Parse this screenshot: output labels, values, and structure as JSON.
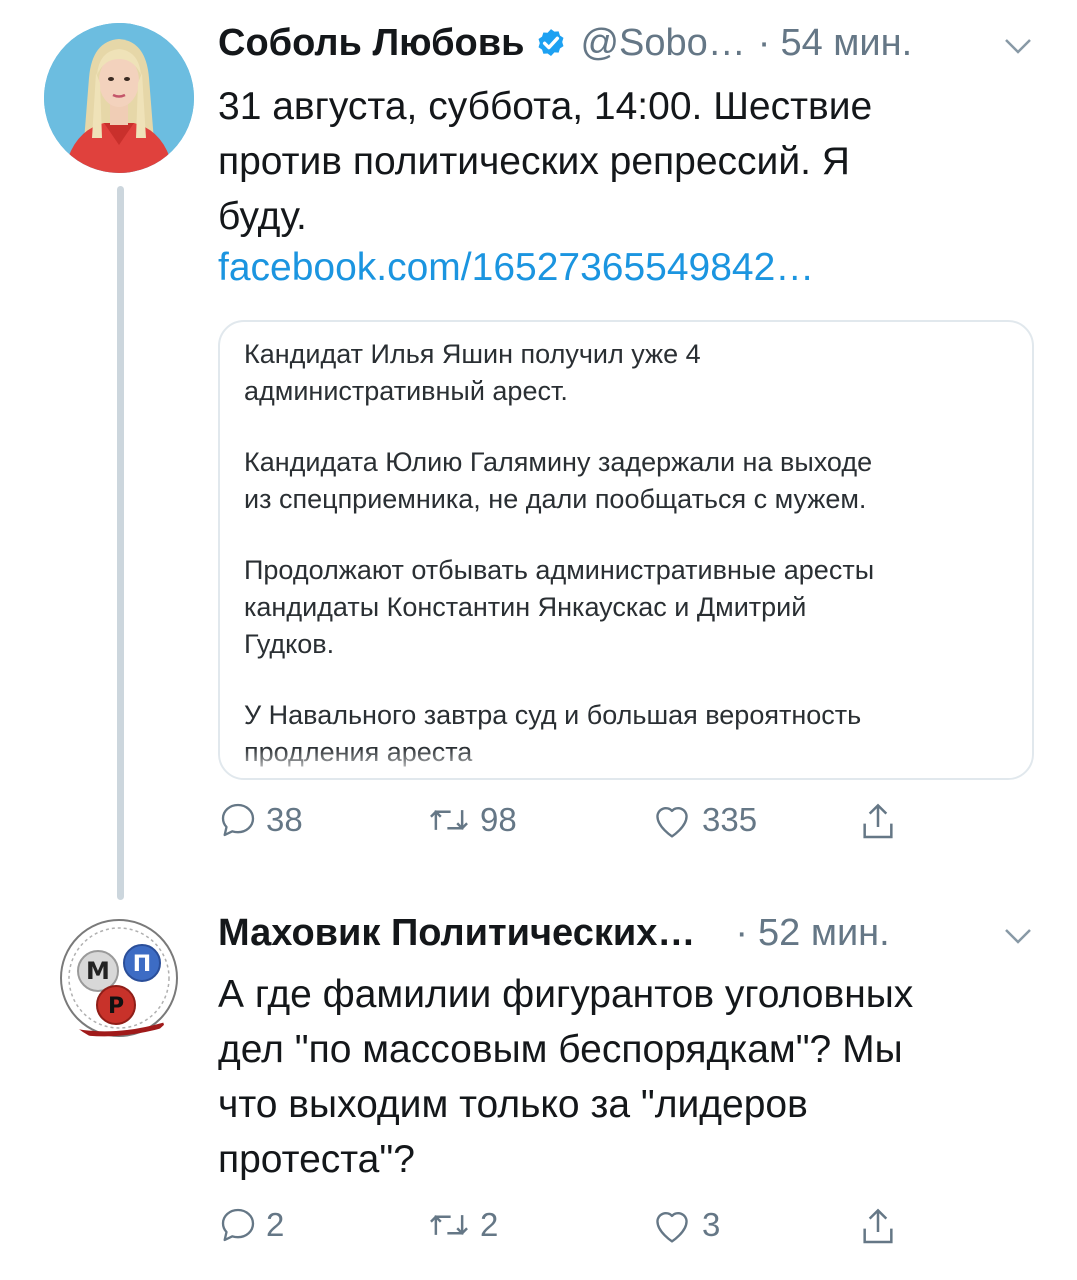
{
  "tweets": [
    {
      "author_name": "Соболь Любовь",
      "handle": "@Sobo…",
      "dot": "·",
      "time": "54 мин.",
      "verified": true,
      "avatar_icon": "person-portrait",
      "text_lines": [
        "31 августа, суббота, 14:00. Шествие",
        "против политических репрессий. Я",
        "буду."
      ],
      "link": "facebook.com/16527365549842…",
      "quoted_card": {
        "paragraphs": [
          [
            "Кандидат Илья Яшин получил уже 4",
            "административный арест."
          ],
          [
            "Кандидата Юлию Галямину задержали на выходе",
            "из спецприемника, не дали пообщаться с мужем."
          ],
          [
            "Продолжают отбывать административные аресты",
            "кандидаты Константин Янкаускас и Дмитрий",
            "Гудков."
          ],
          [
            "У Навального завтра суд и большая вероятность",
            "продления ареста"
          ]
        ]
      },
      "actions": {
        "replies": "38",
        "retweets": "98",
        "likes": "335"
      }
    },
    {
      "author_name": "Маховик Политических…",
      "dot": "·",
      "time": "52 мин.",
      "avatar_icon": "mpr-logo",
      "avatar_letters": [
        "М",
        "П",
        "Р"
      ],
      "text_lines": [
        "А где фамилии фигурантов уголовных",
        "дел \"по массовым беспорядкам\"? Мы",
        "что выходим только за \"лидеров",
        "протеста\"?"
      ],
      "actions": {
        "replies": "2",
        "retweets": "2",
        "likes": "3"
      }
    }
  ],
  "colors": {
    "accent": "#1b95e0",
    "secondary_text": "#657786",
    "thread_line": "#ccd6dd",
    "verified": "#1da1f2"
  }
}
